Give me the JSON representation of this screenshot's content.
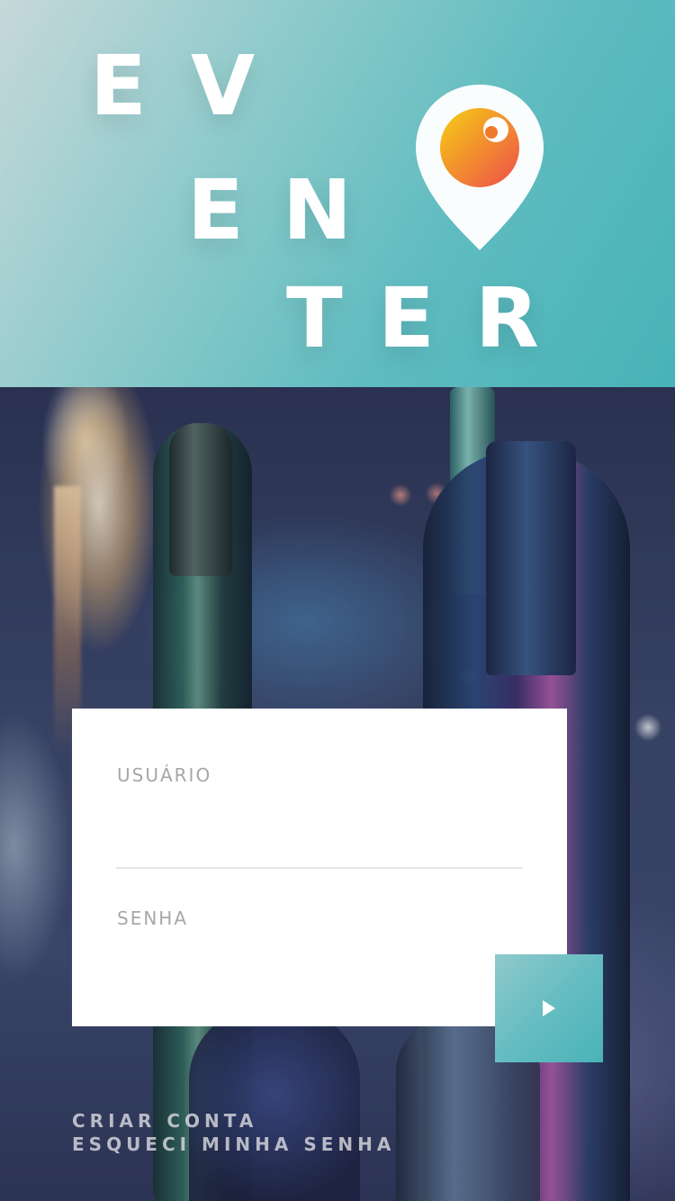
{
  "logo": {
    "letters": [
      "E",
      "V",
      "E",
      "N",
      "T",
      "E",
      "R"
    ],
    "pin_colors": {
      "pin": "#ffffff",
      "eye_top": "#f3c417",
      "eye_bottom": "#f05a44"
    }
  },
  "login": {
    "username_label": "USUÁRIO",
    "password_label": "SENHA",
    "username_value": "",
    "password_value": "",
    "submit_icon": "play-arrow-icon"
  },
  "links": {
    "create_account": "CRIAR CONTA",
    "forgot_password": "ESQUECI MINHA SENHA"
  },
  "colors": {
    "accent": "#4ab3b8",
    "header_gradient_start": "#c6d8da",
    "header_gradient_end": "#47b3b8"
  }
}
